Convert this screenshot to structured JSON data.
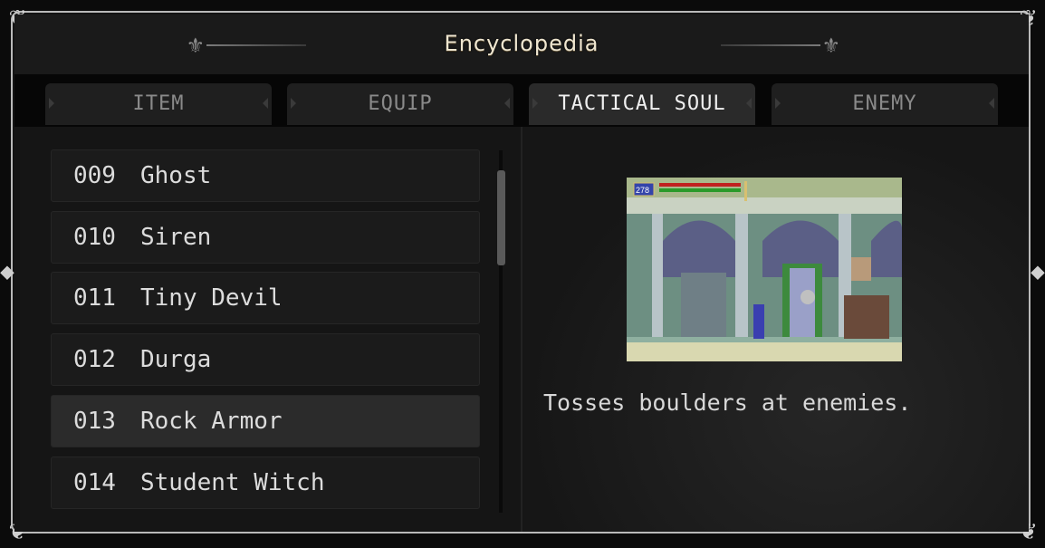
{
  "window": {
    "title": "Encyclopedia"
  },
  "tabs": [
    {
      "label": "ITEM",
      "active": false
    },
    {
      "label": "EQUIP",
      "active": false
    },
    {
      "label": "TACTICAL SOUL",
      "active": true
    },
    {
      "label": "ENEMY",
      "active": false
    }
  ],
  "list": {
    "items": [
      {
        "number": "009",
        "name": "Ghost"
      },
      {
        "number": "010",
        "name": "Siren"
      },
      {
        "number": "011",
        "name": "Tiny Devil"
      },
      {
        "number": "012",
        "name": "Durga"
      },
      {
        "number": "013",
        "name": "Rock Armor",
        "selected": true
      },
      {
        "number": "014",
        "name": "Student Witch"
      }
    ]
  },
  "detail": {
    "preview": {
      "hp_value": "278"
    },
    "description": "Tosses boulders at enemies."
  },
  "colors": {
    "frame_border": "#b9b9b9",
    "active_tab_text": "#f0f0f0",
    "inactive_tab_text": "#8a8a8a",
    "title_text": "#efe6d0"
  }
}
